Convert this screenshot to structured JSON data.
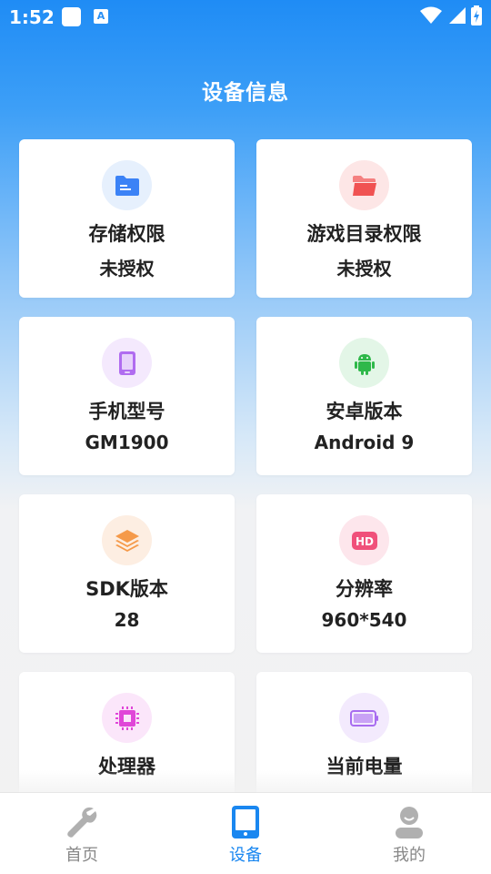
{
  "status_bar": {
    "time": "1:52",
    "badge": "A"
  },
  "header": {
    "title": "设备信息"
  },
  "cards": [
    {
      "label": "存储权限",
      "value": "未授权",
      "icon": "folder-icon",
      "color": "#3b82f6",
      "bg": "#e6f0fd"
    },
    {
      "label": "游戏目录权限",
      "value": "未授权",
      "icon": "folder-open-icon",
      "color": "#f05252",
      "bg": "#fde6e6"
    },
    {
      "label": "手机型号",
      "value": "GM1900",
      "icon": "phone-icon",
      "color": "#b06cf0",
      "bg": "#f4e9fd"
    },
    {
      "label": "安卓版本",
      "value": "Android 9",
      "icon": "android-icon",
      "color": "#2fb84a",
      "bg": "#e3f6e7"
    },
    {
      "label": "SDK版本",
      "value": "28",
      "icon": "layers-icon",
      "color": "#f59a4a",
      "bg": "#fdeee2"
    },
    {
      "label": "分辨率",
      "value": "960*540",
      "icon": "hd-icon",
      "color": "#f0507a",
      "bg": "#fde6ec"
    },
    {
      "label": "处理器",
      "value": "",
      "icon": "chip-icon",
      "color": "#e046d8",
      "bg": "#fbe6fa"
    },
    {
      "label": "当前电量",
      "value": "",
      "icon": "battery-icon",
      "color": "#a86cf0",
      "bg": "#f3eafd"
    }
  ],
  "bottom_nav": [
    {
      "label": "首页",
      "icon": "wrench-icon",
      "active": false
    },
    {
      "label": "设备",
      "icon": "tablet-icon",
      "active": true
    },
    {
      "label": "我的",
      "icon": "user-icon",
      "active": false
    }
  ]
}
